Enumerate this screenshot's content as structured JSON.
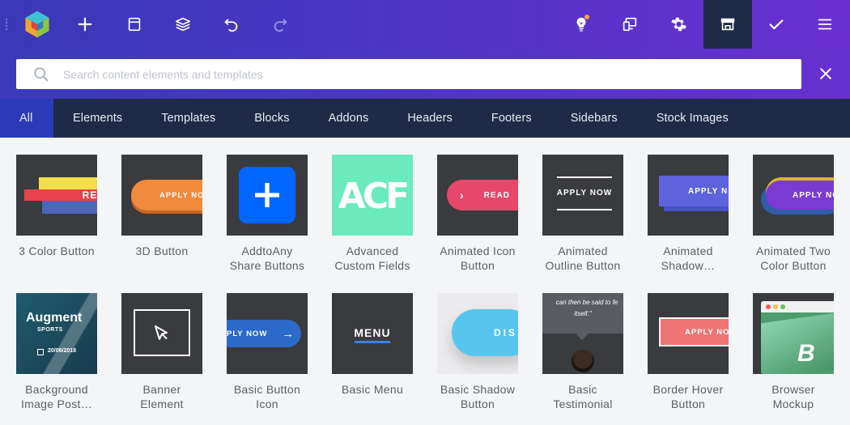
{
  "toolbar": {
    "logo": "logo-icon",
    "buttons": [
      "add-element",
      "templates",
      "layers",
      "undo",
      "redo",
      "hints",
      "responsive",
      "settings",
      "hub",
      "save",
      "menu"
    ],
    "colors": {
      "bg_start": "#3a39b6",
      "bg_end": "#6a2fd2",
      "active": "#1f2a47",
      "notify": "#f5a23a"
    }
  },
  "search": {
    "placeholder": "Search content elements and templates",
    "value": ""
  },
  "tabs": [
    {
      "label": "All",
      "active": true
    },
    {
      "label": "Elements"
    },
    {
      "label": "Templates"
    },
    {
      "label": "Blocks"
    },
    {
      "label": "Addons"
    },
    {
      "label": "Headers"
    },
    {
      "label": "Footers"
    },
    {
      "label": "Sidebars"
    },
    {
      "label": "Stock Images"
    }
  ],
  "elements": [
    {
      "label1": "3 Color Button",
      "label2": "",
      "thumb_text": "REA"
    },
    {
      "label1": "3D Button",
      "label2": "",
      "thumb_text": "APPLY NO"
    },
    {
      "label1": "AddtoAny",
      "label2": "Share Buttons",
      "thumb_text": ""
    },
    {
      "label1": "Advanced",
      "label2": "Custom Fields",
      "thumb_text": "ACF"
    },
    {
      "label1": "Animated Icon",
      "label2": "Button",
      "thumb_text": "READ"
    },
    {
      "label1": "Animated",
      "label2": "Outline Button",
      "thumb_text": "APPLY NOW"
    },
    {
      "label1": "Animated",
      "label2": "Shadow…",
      "thumb_text": "APPLY N"
    },
    {
      "label1": "Animated Two",
      "label2": "Color Button",
      "thumb_text": "APPLY NO"
    },
    {
      "label1": "Background",
      "label2": "Image Post…",
      "thumb_text": "Augment",
      "thumb_sub": "SPORTS",
      "thumb_date": "20/06/2018"
    },
    {
      "label1": "Banner",
      "label2": "Element",
      "thumb_text": ""
    },
    {
      "label1": "Basic Button",
      "label2": "Icon",
      "thumb_text": "PLY NOW"
    },
    {
      "label1": "Basic Menu",
      "label2": "",
      "thumb_text": "MENU"
    },
    {
      "label1": "Basic Shadow",
      "label2": "Button",
      "thumb_text": "DIS"
    },
    {
      "label1": "Basic",
      "label2": "Testimonial",
      "thumb_text": "can then be said to fe",
      "thumb_sub": "itself.\""
    },
    {
      "label1": "Border Hover",
      "label2": "Button",
      "thumb_text": "APPLY NO"
    },
    {
      "label1": "Browser",
      "label2": "Mockup",
      "thumb_text": "B"
    }
  ]
}
